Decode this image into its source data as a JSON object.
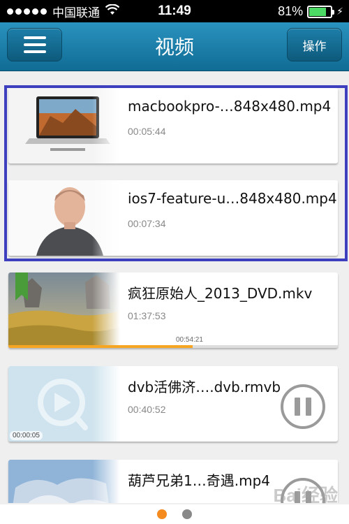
{
  "status_bar": {
    "carrier": "中国联通",
    "time": "11:49",
    "battery_percent": "81%",
    "battery_level": 0.81
  },
  "nav": {
    "title": "视频",
    "operation_label": "操作"
  },
  "videos": [
    {
      "title": "macbookpro-…848x480.mp4",
      "duration": "00:05:44"
    },
    {
      "title": "ios7-feature-u…848x480.mp4",
      "duration": "00:07:34"
    },
    {
      "title": "疯狂原始人_2013_DVD.mkv",
      "duration": "01:37:53",
      "progress_time": "00:54:21",
      "progress_fraction": 0.56
    },
    {
      "title": "dvb活佛济….dvb.rmvb",
      "duration": "00:40:52",
      "thumb_time": "00:00:05"
    },
    {
      "title": "葫芦兄弟1…奇遇.mp4",
      "duration": ""
    }
  ],
  "watermark": "Bai经验",
  "pager": {
    "pages": 2,
    "active": 0
  },
  "colors": {
    "nav_bar": "#1a82ad",
    "selection_border": "#3d3fbf",
    "progress": "#f6a623",
    "page_dot_active": "#f58a1f"
  }
}
